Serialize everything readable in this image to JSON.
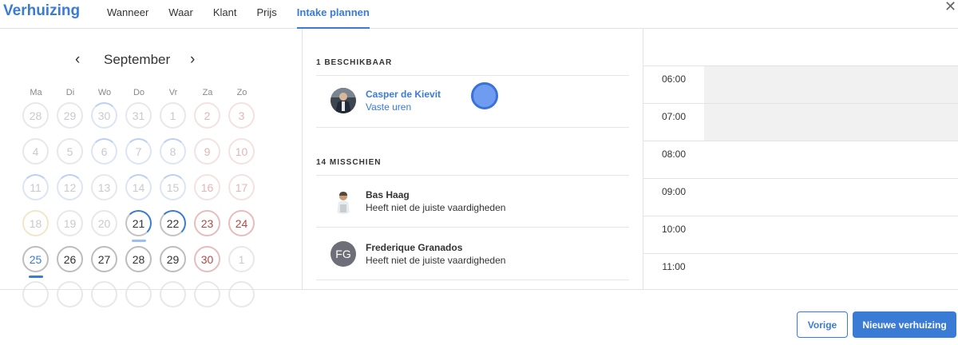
{
  "app_title": "Verhuizing",
  "tabs": [
    {
      "label": "Wanneer"
    },
    {
      "label": "Waar"
    },
    {
      "label": "Klant"
    },
    {
      "label": "Prijs"
    },
    {
      "label": "Intake plannen",
      "active": true
    }
  ],
  "calendar": {
    "month": "September",
    "weekdays": [
      "Ma",
      "Di",
      "Wo",
      "Do",
      "Vr",
      "Za",
      "Zo"
    ],
    "weeks": [
      [
        "28",
        "29",
        "30",
        "31",
        "1",
        "2",
        "3"
      ],
      [
        "4",
        "5",
        "6",
        "7",
        "8",
        "9",
        "10"
      ],
      [
        "11",
        "12",
        "13",
        "14",
        "15",
        "16",
        "17"
      ],
      [
        "18",
        "19",
        "20",
        "21",
        "22",
        "23",
        "24"
      ],
      [
        "25",
        "26",
        "27",
        "28",
        "29",
        "30",
        "1"
      ]
    ]
  },
  "available": {
    "title": "1 BESCHIKBAAR",
    "people": [
      {
        "name": "Casper de Kievit",
        "subtitle": "Vaste uren"
      }
    ]
  },
  "maybe": {
    "title": "14 MISSCHIEN",
    "people": [
      {
        "name": "Bas Haag",
        "subtitle": "Heeft niet de juiste vaardigheden"
      },
      {
        "name": "Frederique Granados",
        "subtitle": "Heeft niet de juiste vaardigheden",
        "initials": "FG"
      }
    ]
  },
  "times": [
    "06:00",
    "07:00",
    "08:00",
    "09:00",
    "10:00",
    "11:00"
  ],
  "footer": {
    "back_label": "Vorige",
    "primary_label": "Nieuwe verhuizing"
  },
  "colors": {
    "accent": "#3a7bd5",
    "weekend": "#b34848"
  },
  "icons": {
    "close": "close-icon",
    "prev": "chevron-left-icon",
    "next": "chevron-right-icon"
  }
}
